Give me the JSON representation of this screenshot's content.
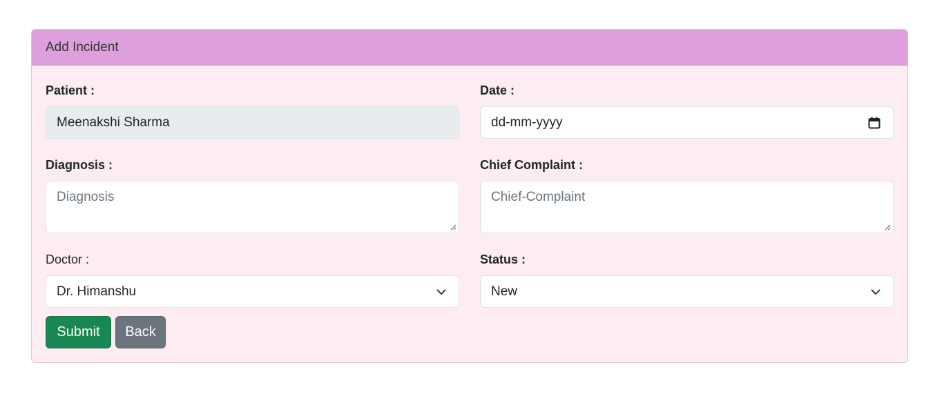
{
  "card": {
    "title": "Add Incident"
  },
  "form": {
    "patient": {
      "label": "Patient :",
      "value": "Meenakshi Sharma"
    },
    "date": {
      "label": "Date :",
      "placeholder": "dd-mm-yyyy",
      "icon": "calendar-icon"
    },
    "diagnosis": {
      "label": "Diagnosis :",
      "placeholder": "Diagnosis"
    },
    "chief_complaint": {
      "label": "Chief Complaint :",
      "placeholder": "Chief-Complaint"
    },
    "doctor": {
      "label": "Doctor :",
      "selected": "Dr. Himanshu",
      "icon": "chevron-down-icon"
    },
    "status": {
      "label": "Status :",
      "selected": "New",
      "icon": "chevron-down-icon"
    }
  },
  "buttons": {
    "submit": "Submit",
    "back": "Back"
  },
  "colors": {
    "header_bg": "#dda0dd",
    "card_bg": "#fdedf3",
    "submit_bg": "#198754",
    "back_bg": "#6c757d",
    "disabled_input_bg": "#e9ecef"
  }
}
